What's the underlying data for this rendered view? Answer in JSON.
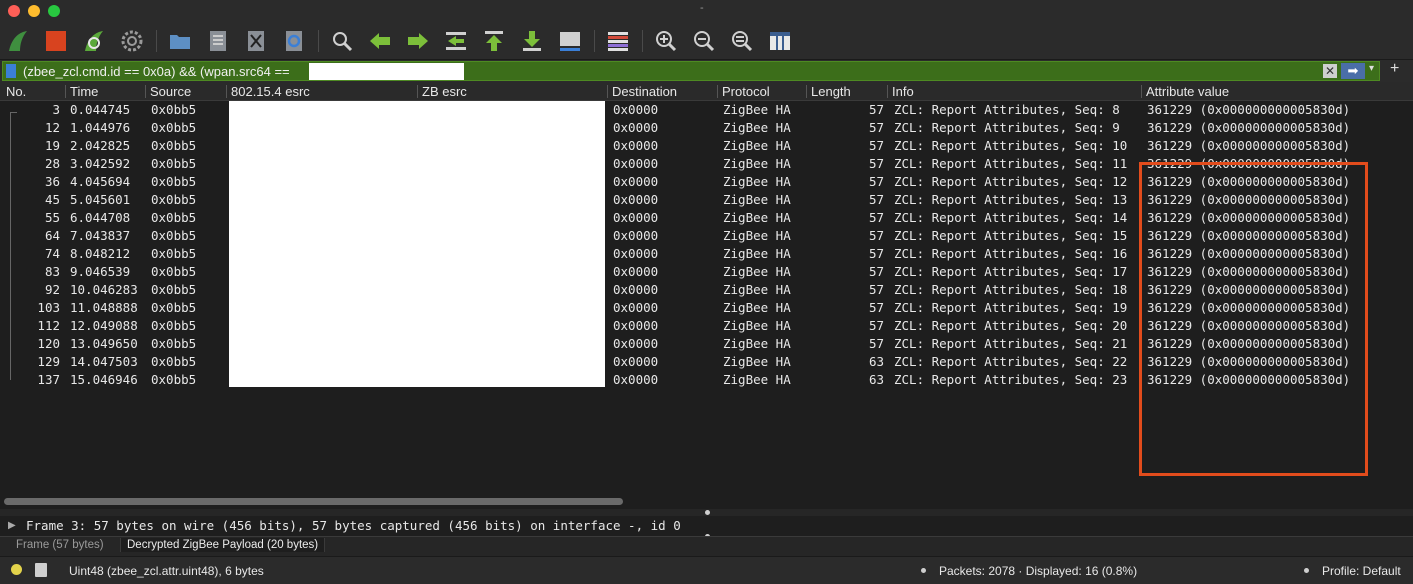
{
  "window": {
    "title": "-"
  },
  "toolbar": {
    "buttons": [
      {
        "name": "start-capture-icon"
      },
      {
        "name": "stop-capture-icon"
      },
      {
        "name": "restart-capture-icon"
      },
      {
        "name": "capture-options-icon"
      },
      {
        "name": "open-file-icon"
      },
      {
        "name": "save-file-icon"
      },
      {
        "name": "close-file-icon"
      },
      {
        "name": "reload-file-icon"
      },
      {
        "name": "find-packet-icon"
      },
      {
        "name": "go-back-icon"
      },
      {
        "name": "go-forward-icon"
      },
      {
        "name": "go-to-packet-icon"
      },
      {
        "name": "go-first-packet-icon"
      },
      {
        "name": "go-last-packet-icon"
      },
      {
        "name": "auto-scroll-icon"
      },
      {
        "name": "colorize-icon"
      },
      {
        "name": "zoom-in-icon"
      },
      {
        "name": "zoom-out-icon"
      },
      {
        "name": "normal-size-icon"
      },
      {
        "name": "resize-columns-icon"
      }
    ]
  },
  "filter": {
    "text": "(zbee_zcl.cmd.id == 0x0a) && (wpan.src64 == ",
    "clear_label": "✕",
    "apply_label": "➡",
    "dropdown_label": "▾",
    "add_label": "+"
  },
  "columns": [
    "No.",
    "Time",
    "Source",
    "802.15.4 esrc",
    "ZB esrc",
    "Destination",
    "Protocol",
    "Length",
    "Info",
    "Attribute value"
  ],
  "packets": [
    {
      "no": "3",
      "time": "0.044745",
      "source": "0x0bb5",
      "destination": "0x0000",
      "protocol": "ZigBee HA",
      "length": "57",
      "info": "ZCL: Report Attributes, Seq: 8",
      "attr": "361229 (0x000000000005830d)"
    },
    {
      "no": "12",
      "time": "1.044976",
      "source": "0x0bb5",
      "destination": "0x0000",
      "protocol": "ZigBee HA",
      "length": "57",
      "info": "ZCL: Report Attributes, Seq: 9",
      "attr": "361229 (0x000000000005830d)"
    },
    {
      "no": "19",
      "time": "2.042825",
      "source": "0x0bb5",
      "destination": "0x0000",
      "protocol": "ZigBee HA",
      "length": "57",
      "info": "ZCL: Report Attributes, Seq: 10",
      "attr": "361229 (0x000000000005830d)"
    },
    {
      "no": "28",
      "time": "3.042592",
      "source": "0x0bb5",
      "destination": "0x0000",
      "protocol": "ZigBee HA",
      "length": "57",
      "info": "ZCL: Report Attributes, Seq: 11",
      "attr": "361229 (0x000000000005830d)"
    },
    {
      "no": "36",
      "time": "4.045694",
      "source": "0x0bb5",
      "destination": "0x0000",
      "protocol": "ZigBee HA",
      "length": "57",
      "info": "ZCL: Report Attributes, Seq: 12",
      "attr": "361229 (0x000000000005830d)"
    },
    {
      "no": "45",
      "time": "5.045601",
      "source": "0x0bb5",
      "destination": "0x0000",
      "protocol": "ZigBee HA",
      "length": "57",
      "info": "ZCL: Report Attributes, Seq: 13",
      "attr": "361229 (0x000000000005830d)"
    },
    {
      "no": "55",
      "time": "6.044708",
      "source": "0x0bb5",
      "destination": "0x0000",
      "protocol": "ZigBee HA",
      "length": "57",
      "info": "ZCL: Report Attributes, Seq: 14",
      "attr": "361229 (0x000000000005830d)"
    },
    {
      "no": "64",
      "time": "7.043837",
      "source": "0x0bb5",
      "destination": "0x0000",
      "protocol": "ZigBee HA",
      "length": "57",
      "info": "ZCL: Report Attributes, Seq: 15",
      "attr": "361229 (0x000000000005830d)"
    },
    {
      "no": "74",
      "time": "8.048212",
      "source": "0x0bb5",
      "destination": "0x0000",
      "protocol": "ZigBee HA",
      "length": "57",
      "info": "ZCL: Report Attributes, Seq: 16",
      "attr": "361229 (0x000000000005830d)"
    },
    {
      "no": "83",
      "time": "9.046539",
      "source": "0x0bb5",
      "destination": "0x0000",
      "protocol": "ZigBee HA",
      "length": "57",
      "info": "ZCL: Report Attributes, Seq: 17",
      "attr": "361229 (0x000000000005830d)"
    },
    {
      "no": "92",
      "time": "10.046283",
      "source": "0x0bb5",
      "destination": "0x0000",
      "protocol": "ZigBee HA",
      "length": "57",
      "info": "ZCL: Report Attributes, Seq: 18",
      "attr": "361229 (0x000000000005830d)"
    },
    {
      "no": "103",
      "time": "11.048888",
      "source": "0x0bb5",
      "destination": "0x0000",
      "protocol": "ZigBee HA",
      "length": "57",
      "info": "ZCL: Report Attributes, Seq: 19",
      "attr": "361229 (0x000000000005830d)"
    },
    {
      "no": "112",
      "time": "12.049088",
      "source": "0x0bb5",
      "destination": "0x0000",
      "protocol": "ZigBee HA",
      "length": "57",
      "info": "ZCL: Report Attributes, Seq: 20",
      "attr": "361229 (0x000000000005830d)"
    },
    {
      "no": "120",
      "time": "13.049650",
      "source": "0x0bb5",
      "destination": "0x0000",
      "protocol": "ZigBee HA",
      "length": "57",
      "info": "ZCL: Report Attributes, Seq: 21",
      "attr": "361229 (0x000000000005830d)"
    },
    {
      "no": "129",
      "time": "14.047503",
      "source": "0x0bb5",
      "destination": "0x0000",
      "protocol": "ZigBee HA",
      "length": "63",
      "info": "ZCL: Report Attributes, Seq: 22",
      "attr": "361229 (0x000000000005830d)"
    },
    {
      "no": "137",
      "time": "15.046946",
      "source": "0x0bb5",
      "destination": "0x0000",
      "protocol": "ZigBee HA",
      "length": "63",
      "info": "ZCL: Report Attributes, Seq: 23",
      "attr": "361229 (0x000000000005830d)"
    }
  ],
  "detail": {
    "arrow": "▶",
    "frame_line": "Frame 3: 57 bytes on wire (456 bits), 57 bytes captured (456 bits) on interface -, id 0"
  },
  "bytes_tabs": [
    "Frame (57 bytes)",
    "Decrypted ZigBee Payload (20 bytes)"
  ],
  "status": {
    "field_info": "Uint48 (zbee_zcl.attr.uint48), 6 bytes",
    "packets": "Packets: 2078 · Displayed: 16 (0.8%)",
    "profile": "Profile: Default"
  },
  "colors": {
    "filter_valid": "#3c6e1a",
    "highlight": "#e24c1c",
    "background": "#1e1e1e"
  }
}
